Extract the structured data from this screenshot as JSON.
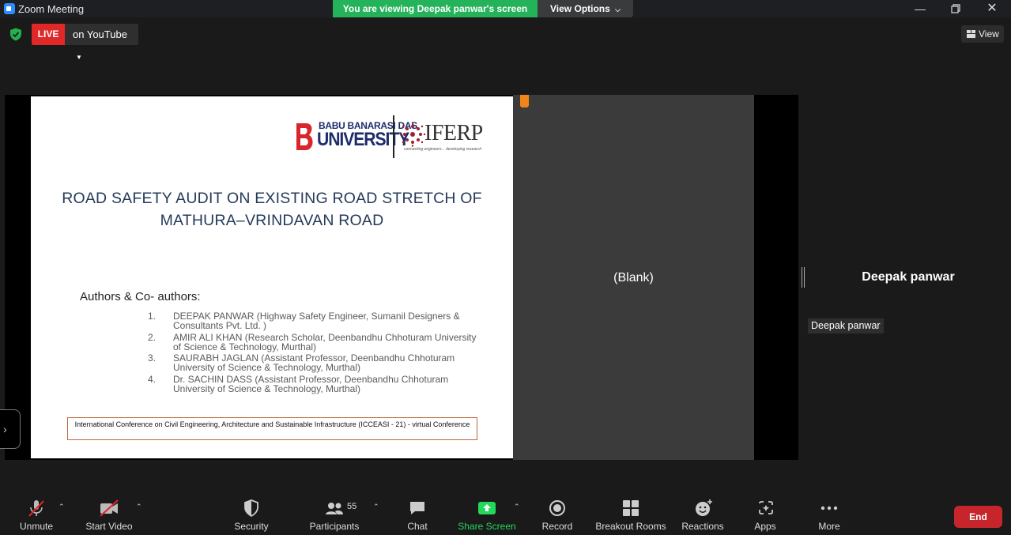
{
  "window": {
    "title": "Zoom Meeting",
    "viewing_banner": "You are viewing Deepak panwar's screen",
    "view_options_label": "View Options"
  },
  "top_bar": {
    "live_badge": "LIVE",
    "live_destination": "on YouTube",
    "view_label": "View"
  },
  "slide": {
    "logo_bbd_line1": "BABU BANARASI DAS",
    "logo_bbd_line2": "UNIVERSITY",
    "logo_iferp": "IFERP",
    "logo_iferp_tagline": "connecting engineers... developing research",
    "title_line1": "ROAD SAFETY AUDIT ON EXISTING ROAD STRETCH OF",
    "title_line2": "MATHURA–VRINDAVAN  ROAD",
    "authors_heading": "Authors & Co- authors:",
    "authors": [
      {
        "num": "1.",
        "text": "DEEPAK PANWAR (Highway Safety Engineer, Sumanil Designers & Consultants Pvt. Ltd. )"
      },
      {
        "num": "2.",
        "text": "AMIR ALI KHAN (Research Scholar, Deenbandhu Chhoturam University of Science & Technology, Murthal)"
      },
      {
        "num": "3.",
        "text": "SAURABH JAGLAN (Assistant Professor, Deenbandhu Chhoturam University of Science & Technology, Murthal)"
      },
      {
        "num": "4.",
        "text": "Dr. SACHIN DASS (Assistant Professor, Deenbandhu Chhoturam University of Science & Technology, Murthal)"
      }
    ],
    "conference": "International Conference on Civil Engineering, Architecture and Sustainable Infrastructure (ICCEASI - 21) - virtual Conference"
  },
  "blank_label": "(Blank)",
  "participant": {
    "name_large": "Deepak panwar",
    "name_tag": "Deepak panwar"
  },
  "toolbar": {
    "unmute": "Unmute",
    "start_video": "Start Video",
    "security": "Security",
    "participants": "Participants",
    "participants_count": "55",
    "chat": "Chat",
    "share_screen": "Share Screen",
    "record": "Record",
    "breakout_rooms": "Breakout Rooms",
    "reactions": "Reactions",
    "apps": "Apps",
    "more": "More",
    "end": "End"
  },
  "colors": {
    "banner_green": "#24b35a",
    "live_red": "#e02828",
    "end_red": "#c5252b",
    "share_green": "#23d959",
    "accent_orange": "#f0861b"
  }
}
